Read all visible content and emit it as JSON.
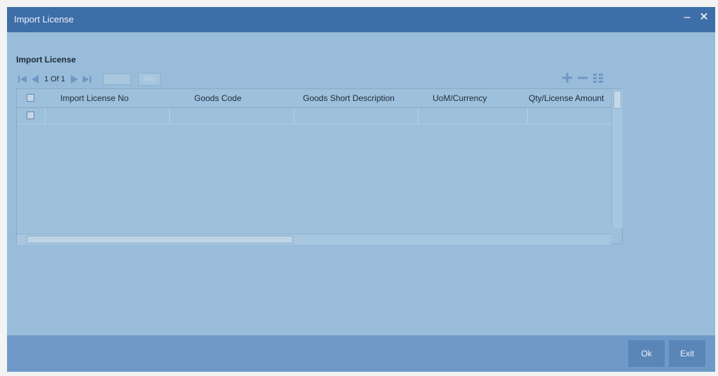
{
  "window": {
    "title": "Import License",
    "minimize_label": "–",
    "close_label": "✕"
  },
  "section": {
    "title": "Import License"
  },
  "pager": {
    "text": "1 Of 1",
    "go_label": "Go",
    "input_value": ""
  },
  "grid": {
    "columns": [
      "Import License No",
      "Goods Code",
      "Goods Short Description",
      "UoM/Currency",
      "Qty/License Amount"
    ],
    "rows": [
      [
        "",
        "",
        "",
        "",
        ""
      ]
    ]
  },
  "footer": {
    "ok_label": "Ok",
    "exit_label": "Exit"
  },
  "icons": {
    "first": "first-page-icon",
    "prev": "prev-page-icon",
    "next": "next-page-icon",
    "last": "last-page-icon",
    "add": "add-row-icon",
    "delete": "delete-row-icon",
    "view": "single-view-icon"
  },
  "colors": {
    "titlebar": "#3e6ea8",
    "body": "#98bcd9",
    "footer": "#6f9ac7",
    "button": "#5a85b7"
  }
}
